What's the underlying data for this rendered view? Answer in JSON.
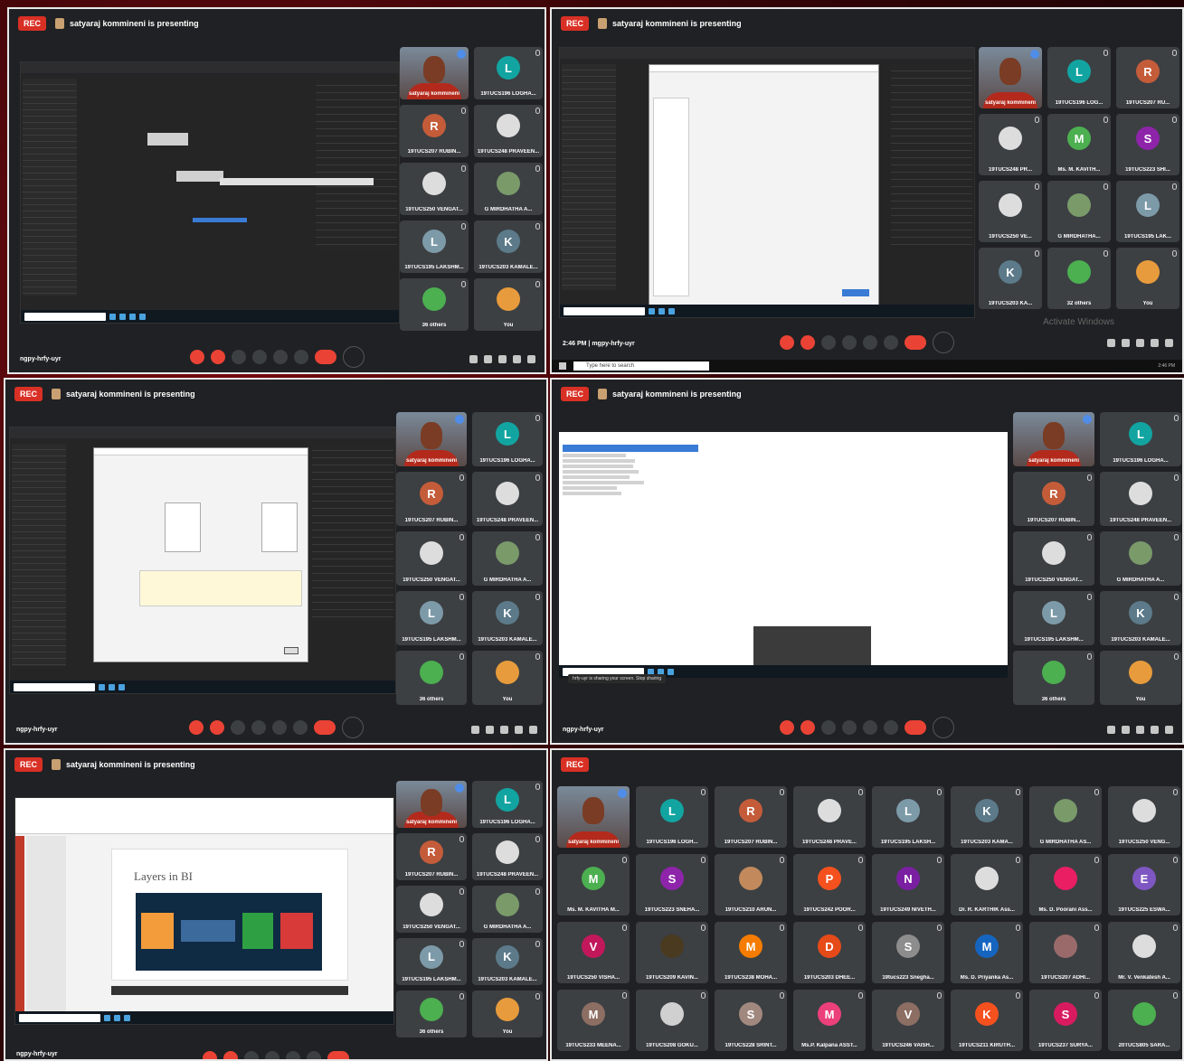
{
  "panels": [
    {
      "id": "p1",
      "rec": "REC",
      "presenting": "satyaraj kommineni is presenting",
      "meeting_code": "ngpy-hrfy-uyr"
    },
    {
      "id": "p2",
      "rec": "REC",
      "presenting": "satyaraj kommineni is presenting",
      "time": "2:46 PM",
      "meeting_code": "mgpy-hrfy-uyr",
      "activate": "Activate Windows",
      "search": "Type here to search"
    },
    {
      "id": "p3",
      "rec": "REC",
      "presenting": "satyaraj kommineni is presenting",
      "meeting_code": "ngpy-hrfy-uyr"
    },
    {
      "id": "p4",
      "rec": "REC",
      "presenting": "satyaraj kommineni is presenting",
      "meeting_code": "ngpy-hrfy-uyr",
      "share_notice": "hrfy-uyr is sharing your screen. Stop sharing"
    },
    {
      "id": "p5",
      "rec": "REC",
      "presenting": "satyaraj kommineni is presenting",
      "meeting_code": "ngpy-hrfy-uyr",
      "slide_title": "Layers in BI"
    },
    {
      "id": "p6",
      "rec": "REC"
    }
  ],
  "participants_small": [
    {
      "initial": "",
      "name": "satyaraj kommineni",
      "color": "#000",
      "cam": true
    },
    {
      "initial": "L",
      "name": "19TUCS196 LOGHA...",
      "color": "#12a4a1"
    },
    {
      "initial": "R",
      "name": "19TUCS207 RUBIN...",
      "color": "#c45c3a"
    },
    {
      "initial": "",
      "name": "19TUCS248 PRAVEEN...",
      "color": "#ddd"
    },
    {
      "initial": "",
      "name": "19TUCS250 VENGAT...",
      "color": "#ddd"
    },
    {
      "initial": "",
      "name": "G MIRDHATHA A...",
      "color": "#7a9a6a"
    },
    {
      "initial": "L",
      "name": "19TUCS195 LAKSHM...",
      "color": "#7d9aa8"
    },
    {
      "initial": "K",
      "name": "19TUCS203 KAMALE...",
      "color": "#5c7a8a"
    },
    {
      "initial": "",
      "name": "36 others",
      "color": "#4caf50"
    },
    {
      "initial": "",
      "name": "You",
      "color": "#e89b3c"
    }
  ],
  "participants_p2": [
    {
      "initial": "",
      "name": "satyaraj kommineni",
      "cam": true
    },
    {
      "initial": "L",
      "name": "19TUCS196 LOG...",
      "color": "#12a4a1"
    },
    {
      "initial": "R",
      "name": "19TUCS207 RU...",
      "color": "#c45c3a"
    },
    {
      "initial": "",
      "name": "19TUCS248 PR...",
      "color": "#ddd"
    },
    {
      "initial": "M",
      "name": "Ms. M. KAVITH...",
      "color": "#4caf50"
    },
    {
      "initial": "S",
      "name": "19TUCS223 SHI...",
      "color": "#8e24aa"
    },
    {
      "initial": "",
      "name": "19TUCS250 VE...",
      "color": "#ddd"
    },
    {
      "initial": "",
      "name": "G MIRDHATHA...",
      "color": "#7a9a6a"
    },
    {
      "initial": "L",
      "name": "19TUCS195 LAK...",
      "color": "#7d9aa8"
    },
    {
      "initial": "K",
      "name": "19TUCS203 KA...",
      "color": "#5c7a8a"
    },
    {
      "initial": "",
      "name": "32 others",
      "color": "#4caf50"
    },
    {
      "initial": "",
      "name": "You",
      "color": "#e89b3c"
    }
  ],
  "participants_p6": [
    {
      "initial": "",
      "name": "satyaraj kommineni",
      "cam": true
    },
    {
      "initial": "L",
      "name": "19TUCS196 LOGH...",
      "color": "#12a4a1"
    },
    {
      "initial": "R",
      "name": "19TUCS207 RUBIN...",
      "color": "#c45c3a"
    },
    {
      "initial": "",
      "name": "19TUCS248 PRAVE...",
      "color": "#ddd"
    },
    {
      "initial": "L",
      "name": "19TUCS195 LAKSH...",
      "color": "#7d9aa8"
    },
    {
      "initial": "K",
      "name": "19TUCS203 KAMA...",
      "color": "#5c7a8a"
    },
    {
      "initial": "",
      "name": "G MIRDHATHA AS...",
      "color": "#7a9a6a"
    },
    {
      "initial": "",
      "name": "19TUCS250 VENG...",
      "color": "#ddd"
    },
    {
      "initial": "M",
      "name": "Ms. M. KAVITHA M...",
      "color": "#4caf50"
    },
    {
      "initial": "S",
      "name": "19TUCS223 SNEHA...",
      "color": "#8e24aa"
    },
    {
      "initial": "",
      "name": "19TUCS210 ARUN...",
      "color": "#c28a5c"
    },
    {
      "initial": "P",
      "name": "19TUCS242 POOR...",
      "color": "#f4511e"
    },
    {
      "initial": "N",
      "name": "19TUCS249 NIVETH...",
      "color": "#7b1fa2"
    },
    {
      "initial": "",
      "name": "Dr. R. KARTHIK Ass...",
      "color": "#ddd"
    },
    {
      "initial": "",
      "name": "Ms. D. Poorani Ass...",
      "color": "#e91e63"
    },
    {
      "initial": "E",
      "name": "19TUCS225 ESWA...",
      "color": "#7e57c2"
    },
    {
      "initial": "V",
      "name": "19TUCS250 VISHA...",
      "color": "#c2185b"
    },
    {
      "initial": "",
      "name": "19TUCS209 KAVIN...",
      "color": "#4a3a20"
    },
    {
      "initial": "M",
      "name": "19TUCS238 MOHA...",
      "color": "#f57c00"
    },
    {
      "initial": "D",
      "name": "19TUCS203 DHEE...",
      "color": "#e64a19"
    },
    {
      "initial": "S",
      "name": "19tucs223 Snegha...",
      "color": "#8d8d8d"
    },
    {
      "initial": "M",
      "name": "Ms. D. Priyanka As...",
      "color": "#1565c0"
    },
    {
      "initial": "",
      "name": "19TUCS207 ADHI...",
      "color": "#9a6a6a"
    },
    {
      "initial": "",
      "name": "Mr. V. Venkatesh A...",
      "color": "#ddd"
    },
    {
      "initial": "M",
      "name": "19TUCS233 MEENA...",
      "color": "#8d6e63"
    },
    {
      "initial": "",
      "name": "19TUCS208 GOKU...",
      "color": "#d0d0d0"
    },
    {
      "initial": "S",
      "name": "19TUCS228 SRINT...",
      "color": "#a1887f"
    },
    {
      "initial": "M",
      "name": "Ms.P. Kalpana ASST...",
      "color": "#ec407a"
    },
    {
      "initial": "V",
      "name": "19TUCS246 VAISH...",
      "color": "#8d6e63"
    },
    {
      "initial": "K",
      "name": "19TUCS211 KIRUTH...",
      "color": "#f4511e"
    },
    {
      "initial": "S",
      "name": "19TUCS237 SURYA...",
      "color": "#d81b60"
    },
    {
      "initial": "",
      "name": "20TUCS805 SARA...",
      "color": "#4caf50"
    }
  ]
}
